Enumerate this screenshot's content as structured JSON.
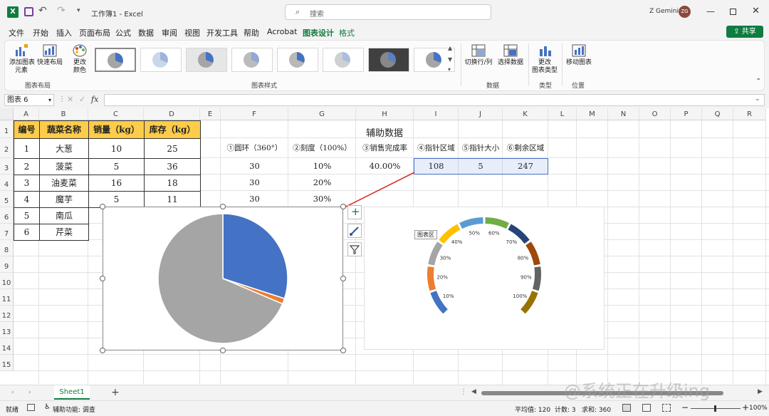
{
  "titlebar": {
    "title": "工作簿1 - Excel",
    "search_placeholder": "搜索",
    "user_name": "Z Gemini",
    "avatar_initials": "ZG",
    "share_label": "共享"
  },
  "ribbon_tabs": [
    {
      "label": "文件"
    },
    {
      "label": "开始"
    },
    {
      "label": "插入"
    },
    {
      "label": "页面布局"
    },
    {
      "label": "公式"
    },
    {
      "label": "数据"
    },
    {
      "label": "审阅"
    },
    {
      "label": "视图"
    },
    {
      "label": "开发工具"
    },
    {
      "label": "帮助"
    },
    {
      "label": "Acrobat"
    },
    {
      "label": "图表设计",
      "active": true
    },
    {
      "label": "格式"
    }
  ],
  "ribbon": {
    "add_element": "添加图表\n元素",
    "quick_layout": "快速布局",
    "change_colors": "更改\n颜色",
    "group_layout": "图表布局",
    "group_styles": "图表样式",
    "switch_row_col": "切换行/列",
    "select_data": "选择数据",
    "group_data": "数据",
    "change_type": "更改\n图表类型",
    "group_type": "类型",
    "move_chart": "移动图表",
    "group_location": "位置"
  },
  "formulabar": {
    "name_box": "图表 6",
    "fx": "fx",
    "formula": ""
  },
  "columns": [
    "A",
    "B",
    "C",
    "D",
    "E",
    "F",
    "G",
    "H",
    "I",
    "J",
    "K",
    "L",
    "M",
    "N",
    "O",
    "P",
    "Q",
    "R"
  ],
  "rows": [
    "1",
    "2",
    "3",
    "4",
    "5",
    "6",
    "7",
    "8",
    "9",
    "10",
    "11",
    "12",
    "13",
    "14",
    "15"
  ],
  "table": {
    "headers": [
      "编号",
      "蔬菜名称",
      "销量（kg）",
      "库存（kg）"
    ],
    "rows": [
      [
        "1",
        "大葱",
        "10",
        "25"
      ],
      [
        "2",
        "菠菜",
        "5",
        "36"
      ],
      [
        "3",
        "油麦菜",
        "16",
        "18"
      ],
      [
        "4",
        "魔芋",
        "5",
        "11"
      ],
      [
        "5",
        "南瓜",
        "",
        ""
      ],
      [
        "6",
        "芹菜",
        "",
        ""
      ]
    ]
  },
  "aux": {
    "title": "辅助数据",
    "headers": [
      "①圆环（360°）",
      "②刻度（100%）",
      "③销售完成率",
      "④指针区域",
      "⑤指针大小",
      "⑥剩余区域"
    ],
    "row3": [
      "30",
      "10%",
      "40.00%",
      "108",
      "5",
      "247"
    ],
    "row4": [
      "30",
      "20%"
    ],
    "row5": [
      "30",
      "30%"
    ]
  },
  "chart_data": [
    {
      "type": "pie",
      "categories": [
        "指针区域",
        "指针大小",
        "剩余区域"
      ],
      "values": [
        108,
        5,
        247
      ],
      "colors": [
        "#4472c4",
        "#ed7d31",
        "#a5a5a5"
      ],
      "title": ""
    },
    {
      "type": "pie",
      "subtype": "doughnut-gauge",
      "tooltip": "图表区",
      "tick_labels": [
        "10%",
        "20%",
        "30%",
        "40%",
        "50%",
        "60%",
        "70%",
        "80%",
        "90%",
        "100%"
      ],
      "segment_colors": [
        "#4472c4",
        "#ed7d31",
        "#a5a5a5",
        "#ffc000",
        "#5b9bd5",
        "#70ad47",
        "#264478",
        "#9e480e",
        "#636363",
        "#997300"
      ],
      "title": ""
    }
  ],
  "sheet_tabs": {
    "active": "Sheet1",
    "add": "+"
  },
  "statusbar": {
    "ready": "就绪",
    "accessibility": "辅助功能: 调查",
    "average": "平均值: 120",
    "count": "计数: 3",
    "sum": "求和: 360",
    "zoom": "100%"
  },
  "watermark": "@系统正在升级ing"
}
